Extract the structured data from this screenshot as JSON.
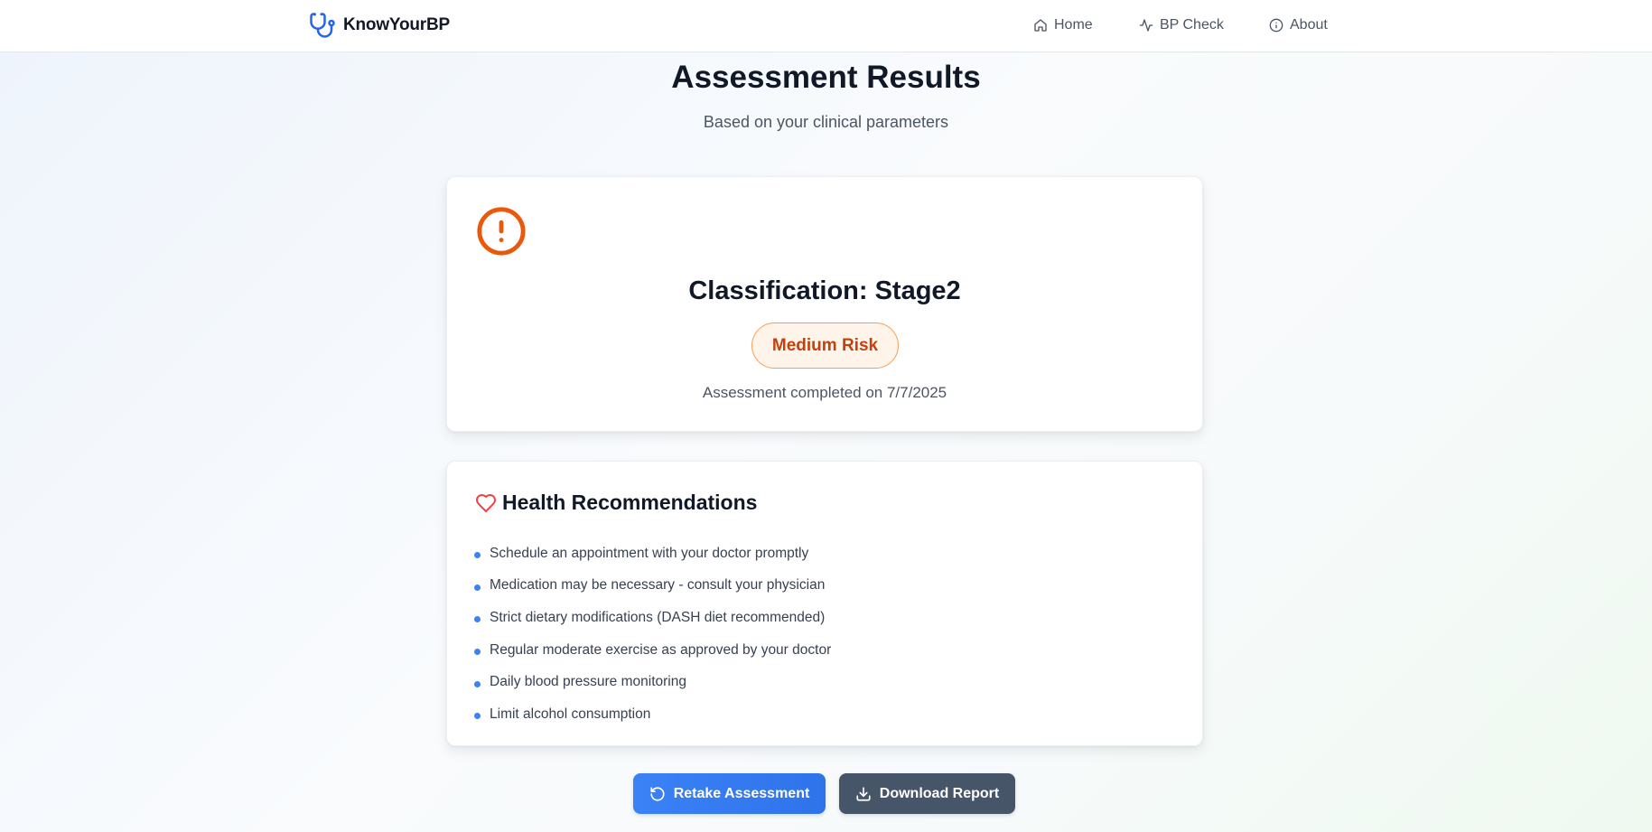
{
  "navbar": {
    "brand": "KnowYourBP",
    "links": [
      {
        "label": "Home",
        "icon": "home-icon"
      },
      {
        "label": "BP Check",
        "icon": "activity-icon"
      },
      {
        "label": "About",
        "icon": "info-icon"
      }
    ]
  },
  "header": {
    "title": "Assessment Results",
    "subtitle": "Based on your clinical parameters"
  },
  "result": {
    "icon": "alert-circle-icon",
    "classification": "Classification: Stage2",
    "risk": "Medium Risk",
    "completed": "Assessment completed on 7/7/2025"
  },
  "recommendations": {
    "icon": "heart-icon",
    "title": "Health Recommendations",
    "items": [
      "Schedule an appointment with your doctor promptly",
      "Medication may be necessary - consult your physician",
      "Strict dietary modifications (DASH diet recommended)",
      "Regular moderate exercise as approved by your doctor",
      "Daily blood pressure monitoring",
      "Limit alcohol consumption"
    ]
  },
  "actions": {
    "retake": "Retake Assessment",
    "download": "Download Report"
  },
  "colors": {
    "primary": "#3b82f6",
    "alert": "#ea580c",
    "risk_text": "#c2410c",
    "heart": "#ef4444",
    "download_bg": "#475569"
  }
}
